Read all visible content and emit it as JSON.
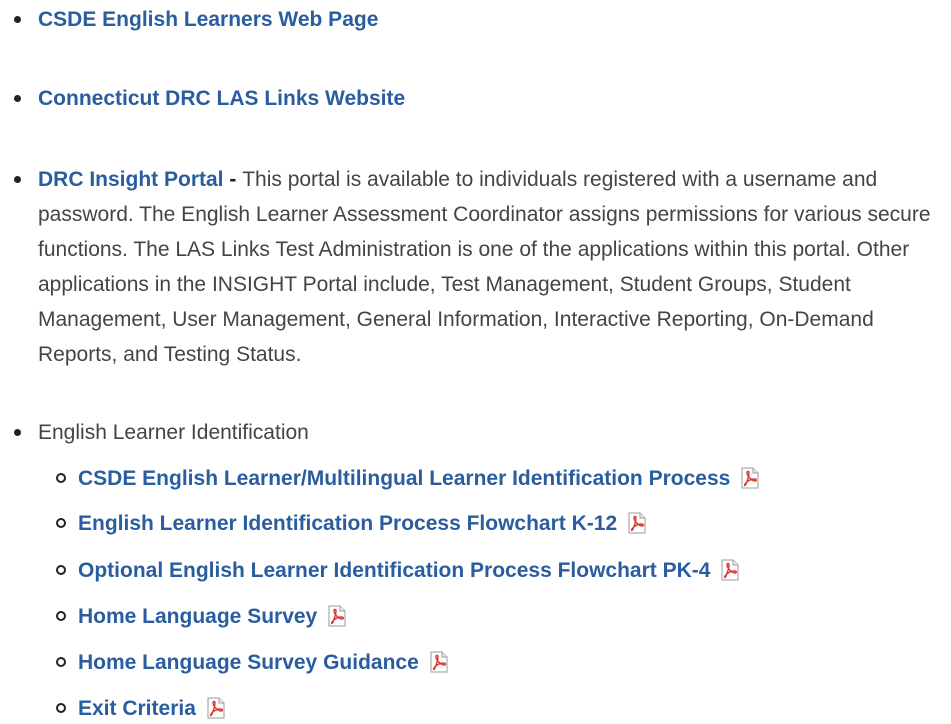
{
  "links": {
    "csde_el_web_page": "CSDE English Learners Web Page",
    "ct_drc_las_links": "Connecticut DRC LAS Links Website",
    "drc_insight_portal": "DRC Insight Portal"
  },
  "insight_description": {
    "separator": " - ",
    "text": "This portal is available to individuals registered with a username and password. The English Learner Assessment Coordinator assigns permissions for various secure functions. The LAS Links Test Administration is one of the applications within this portal. Other applications in the INSIGHT Portal include, Test Management, Student Groups, Student Management, User Management, General Information, Interactive Reporting, On-Demand Reports, and Testing Status."
  },
  "el_identification": {
    "heading": "English Learner Identification",
    "items": [
      {
        "label": "CSDE English Learner/Multilingual Learner Identification Process",
        "icon": "pdf-icon"
      },
      {
        "label": "English Learner Identification Process Flowchart K-12",
        "icon": "pdf-icon"
      },
      {
        "label": "Optional English Learner Identification Process Flowchart PK-4",
        "icon": "pdf-icon"
      },
      {
        "label": "Home Language Survey",
        "icon": "pdf-icon"
      },
      {
        "label": "Home Language Survey Guidance",
        "icon": "pdf-icon"
      },
      {
        "label": "Exit Criteria",
        "icon": "pdf-icon"
      }
    ]
  },
  "colors": {
    "link": "#2a5d9f",
    "body_text": "#555555",
    "pdf_red": "#d9342b"
  }
}
